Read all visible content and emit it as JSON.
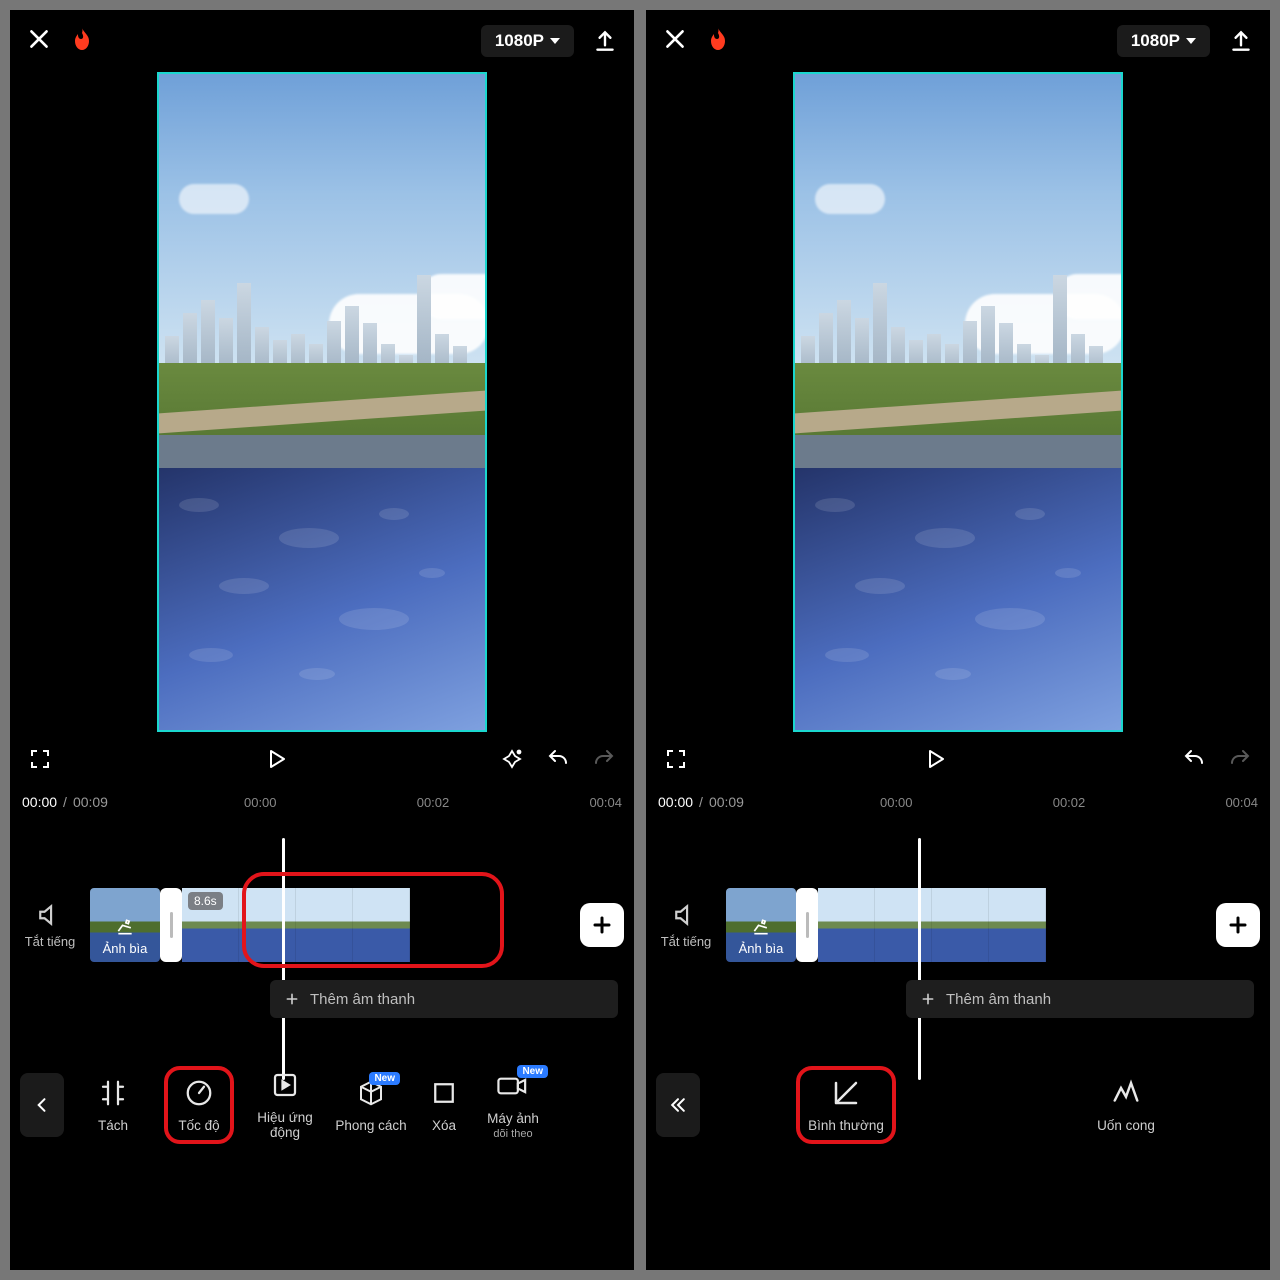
{
  "header": {
    "resolution_label": "1080P"
  },
  "time": {
    "current": "00:00",
    "total": "00:09",
    "ticks": [
      "00:00",
      "00:02",
      "00:04"
    ]
  },
  "timeline": {
    "mute_label": "Tắt tiếng",
    "cover_label": "Ảnh bìa",
    "clip_duration": "8.6s",
    "add_audio_label": "Thêm âm thanh"
  },
  "tools_left": {
    "new_badge": "New",
    "items": [
      {
        "label": "Tách"
      },
      {
        "label": "Tốc độ"
      },
      {
        "label": "Hiệu ứng động"
      },
      {
        "label": "Phong cách"
      },
      {
        "label": "Xóa"
      },
      {
        "label": "Máy ảnh",
        "sub": "dõi theo"
      }
    ]
  },
  "tools_right": {
    "items": [
      {
        "label": "Bình thường"
      },
      {
        "label": "Uốn cong"
      }
    ]
  }
}
